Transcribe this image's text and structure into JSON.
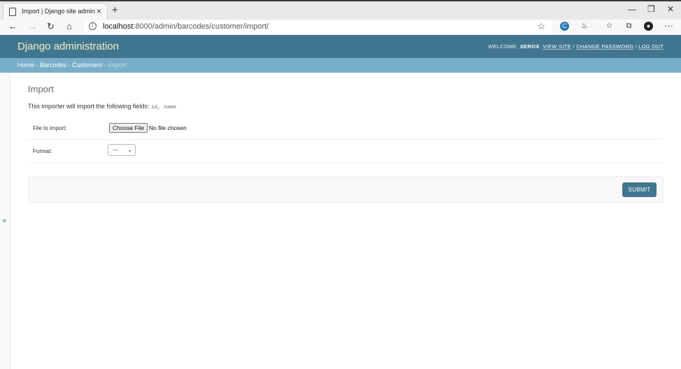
{
  "browser": {
    "tab_title": "Import | Django site admin",
    "tab_close": "×",
    "new_tab": "+",
    "window_controls": [
      "—",
      "❐",
      "✕"
    ],
    "nav": {
      "back": "←",
      "forward": "→",
      "refresh": "↻",
      "home": "⌂"
    },
    "url_host": "localhost",
    "url_rest": ":8000/admin/barcodes/customer/import/",
    "favorite": "☆",
    "more": "···"
  },
  "header": {
    "site_name": "Django administration",
    "welcome": "WELCOME,",
    "username": "XEROX",
    "view_site": "VIEW SITE",
    "change_password": "CHANGE PASSWORD",
    "log_out": "LOG OUT",
    "sep": "/"
  },
  "breadcrumbs": {
    "home": "Home",
    "app": "Barcodes",
    "model": "Customers",
    "current": "Import",
    "sep": "›"
  },
  "sidebar": {
    "toggle": "»"
  },
  "main": {
    "title": "Import",
    "intro": "This importer will import the following fields:",
    "fields": "id, name",
    "file_label": "File to import:",
    "file_button": "Choose File",
    "file_status": "No file chosen",
    "format_label": "Format:",
    "format_value": "---",
    "submit": "SUBMIT"
  },
  "colors": {
    "header": "#417690",
    "breadcrumbs": "#79aec8"
  }
}
